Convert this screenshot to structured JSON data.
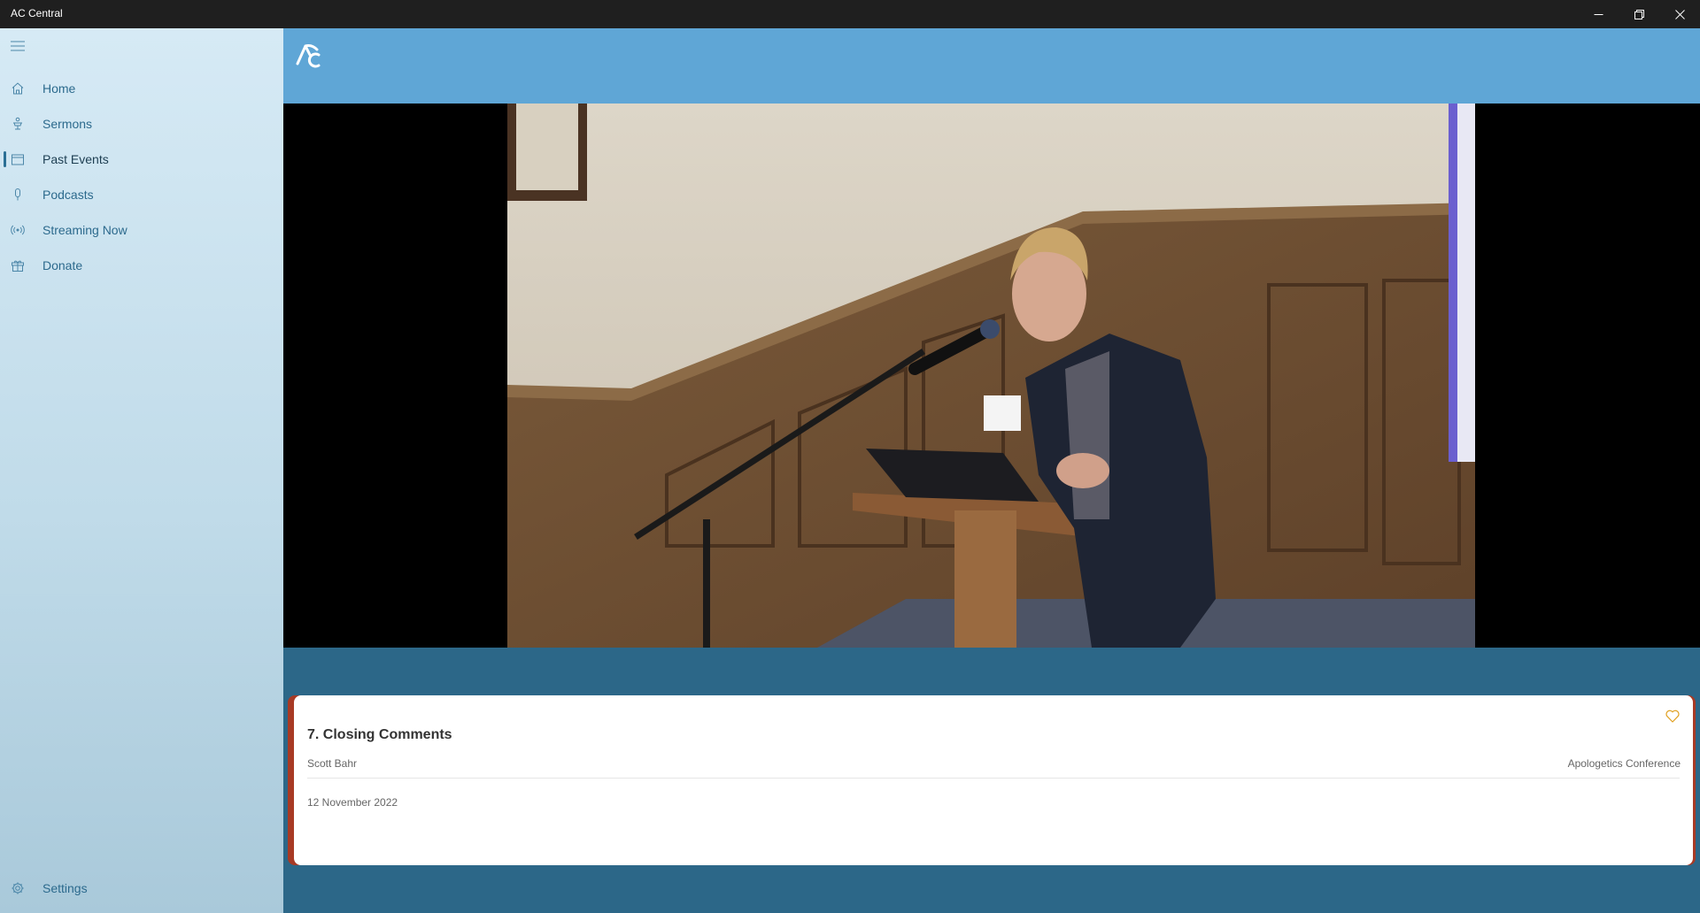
{
  "window": {
    "title": "AC Central",
    "controls": {
      "minimize": "minimize-icon",
      "maximize": "restore-icon",
      "close": "close-icon"
    }
  },
  "sidebar": {
    "menu_icon": "hamburger-icon",
    "items": [
      {
        "label": "Home",
        "icon": "home-icon",
        "selected": false
      },
      {
        "label": "Sermons",
        "icon": "pulpit-icon",
        "selected": false
      },
      {
        "label": "Past Events",
        "icon": "calendar-icon",
        "selected": true
      },
      {
        "label": "Podcasts",
        "icon": "microphone-icon",
        "selected": false
      },
      {
        "label": "Streaming Now",
        "icon": "broadcast-icon",
        "selected": false
      },
      {
        "label": "Donate",
        "icon": "gift-icon",
        "selected": false
      }
    ],
    "settings": {
      "label": "Settings",
      "icon": "gear-icon"
    }
  },
  "header": {
    "logo": "ac-logo"
  },
  "video": {
    "description": "speaker-at-podium"
  },
  "event_card": {
    "title": "7. Closing Comments",
    "speaker": "Scott Bahr",
    "event": "Apologetics Conference",
    "date": "12 November 2022",
    "favorite_icon": "heart-icon"
  },
  "colors": {
    "titlebar": "#1f1f1f",
    "header": "#5fa6d6",
    "content_bg": "#2c6788",
    "accent": "#a83a25",
    "nav_text": "#2c6a8d",
    "favorite": "#e0a020"
  }
}
